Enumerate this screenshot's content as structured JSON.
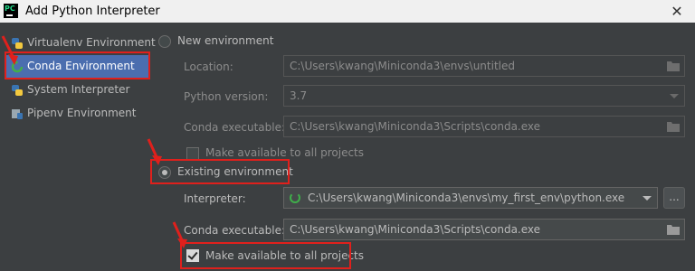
{
  "window": {
    "title": "Add Python Interpreter",
    "app_icon_text": "PC",
    "close_glyph": "✕"
  },
  "sidebar": {
    "items": [
      {
        "label": "Virtualenv Environment",
        "icon": "python-icon",
        "selected": false
      },
      {
        "label": "Conda Environment",
        "icon": "conda-icon",
        "selected": true
      },
      {
        "label": "System Interpreter",
        "icon": "python-icon",
        "selected": false
      },
      {
        "label": "Pipenv Environment",
        "icon": "pipenv-icon",
        "selected": false
      }
    ]
  },
  "new_env": {
    "radio_label": "New environment",
    "selected": false,
    "location_label": "Location:",
    "location_value": "C:\\Users\\kwang\\Miniconda3\\envs\\untitled",
    "python_version_label": "Python version:",
    "python_version_value": "3.7",
    "conda_exec_label": "Conda executable:",
    "conda_exec_value": "C:\\Users\\kwang\\Miniconda3\\Scripts\\conda.exe",
    "make_available_label": "Make available to all projects",
    "make_available_checked": false
  },
  "existing_env": {
    "radio_label": "Existing environment",
    "selected": true,
    "interpreter_label": "Interpreter:",
    "interpreter_value": "C:\\Users\\kwang\\Miniconda3\\envs\\my_first_env\\python.exe",
    "browse_label": "...",
    "conda_exec_label": "Conda executable:",
    "conda_exec_value": "C:\\Users\\kwang\\Miniconda3\\Scripts\\conda.exe",
    "make_available_label": "Make available to all projects",
    "make_available_checked": true
  },
  "colors": {
    "background": "#3c3f41",
    "selection": "#4b6eaf",
    "highlight_red": "#e0201c",
    "text": "#bbbbbb"
  }
}
